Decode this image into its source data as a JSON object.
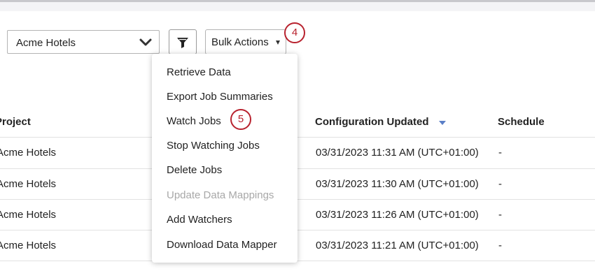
{
  "toolbar": {
    "project_select_value": "Acme Hotels",
    "bulk_actions_label": "Bulk Actions"
  },
  "callouts": [
    "4",
    "5"
  ],
  "table": {
    "headers": {
      "project": "Project",
      "configuration_updated": "Configuration Updated",
      "schedule": "Schedule"
    },
    "rows": [
      {
        "project": "Acme Hotels",
        "configuration_updated": "03/31/2023 11:31 AM (UTC+01:00)",
        "schedule": "-"
      },
      {
        "project": "Acme Hotels",
        "configuration_updated": "03/31/2023 11:30 AM (UTC+01:00)",
        "schedule": "-"
      },
      {
        "project": "Acme Hotels",
        "configuration_updated": "03/31/2023 11:26 AM (UTC+01:00)",
        "schedule": "-"
      },
      {
        "project": "Acme Hotels",
        "configuration_updated": "03/31/2023 11:21 AM (UTC+01:00)",
        "schedule": "-"
      }
    ]
  },
  "bulk_menu": {
    "items": [
      {
        "label": "Retrieve Data",
        "disabled": false
      },
      {
        "label": "Export Job Summaries",
        "disabled": false
      },
      {
        "label": "Watch Jobs",
        "disabled": false
      },
      {
        "label": "Stop Watching Jobs",
        "disabled": false
      },
      {
        "label": "Delete Jobs",
        "disabled": false
      },
      {
        "label": "Update Data Mappings",
        "disabled": true
      },
      {
        "label": "Add Watchers",
        "disabled": false
      },
      {
        "label": "Download Data Mapper",
        "disabled": false
      }
    ]
  },
  "colors": {
    "callout": "#b8222e",
    "sort_indicator": "#5b7fc7",
    "disabled_text": "#a8a8a8"
  },
  "icons": {
    "project_dropdown": "chevron-down-icon",
    "filter": "filter-icon",
    "bulk_caret": "caret-down-icon",
    "sort": "sort-descending-icon"
  }
}
